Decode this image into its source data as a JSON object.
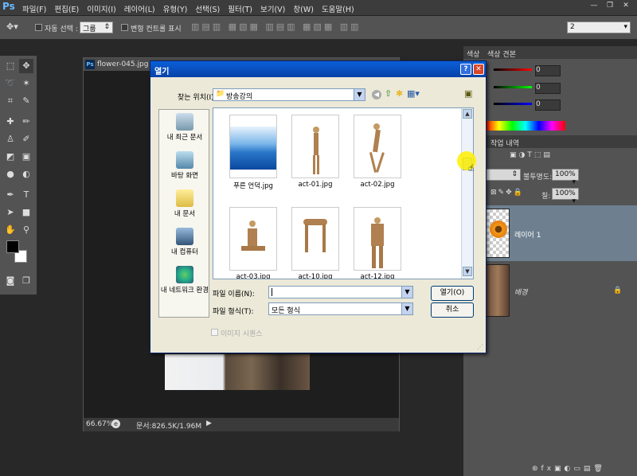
{
  "app": {
    "logo": "Ps"
  },
  "menu": [
    "파일(F)",
    "편집(E)",
    "이미지(I)",
    "레이어(L)",
    "유형(Y)",
    "선택(S)",
    "필터(T)",
    "보기(V)",
    "창(W)",
    "도움말(H)"
  ],
  "options": {
    "auto_select_label": "자동 선택 :",
    "auto_select_value": "그룹",
    "transform_label": "변형 컨트롤 표시",
    "workspace_value": "2"
  },
  "document": {
    "tab_title": "flower-045.jpg @ 66",
    "zoom": "66.67%",
    "status": "문서:826.5K/1.96M"
  },
  "panels": {
    "color_tab": "색상",
    "swatch_tab": "색상 견본",
    "history_tab": "작업 내역",
    "slider_values": [
      "0",
      "0",
      "0"
    ],
    "opacity_label": "불투명도:",
    "opacity_value": "100%",
    "fill_label": "칠:",
    "fill_value": "100%",
    "layer1": "레이어 1",
    "background": "배경"
  },
  "dialog": {
    "title": "열기",
    "look_in_label": "찾는 위치(I):",
    "look_in_value": "방송강의",
    "places": [
      "내 최근 문서",
      "바탕 화면",
      "내 문서",
      "내 컴퓨터",
      "내 네트워크 환경"
    ],
    "files": [
      "푸른 언덕.jpg",
      "act-01.jpg",
      "act-02.jpg",
      "act-03.jpg",
      "act-10.jpg",
      "act-12.jpg"
    ],
    "filename_label": "파일 이름(N):",
    "filename_value": "",
    "filetype_label": "파일 형식(T):",
    "filetype_value": "모든 형식",
    "open_button": "열기(O)",
    "cancel_button": "취소",
    "image_sequence": "이미지 시퀀스"
  }
}
